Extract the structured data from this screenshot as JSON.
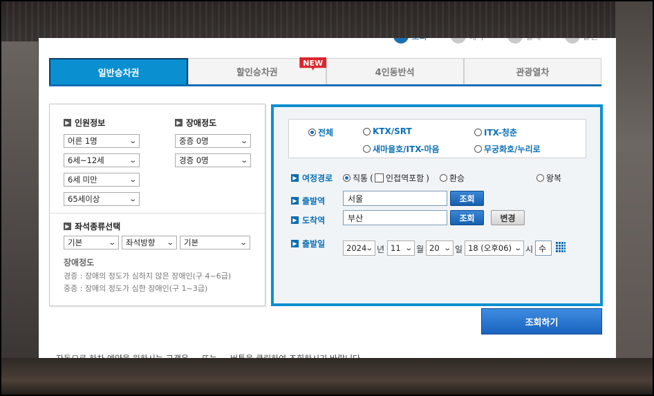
{
  "steps": [
    {
      "label": "조회",
      "active": true
    },
    {
      "label": "예약",
      "active": false
    },
    {
      "label": "결제",
      "active": false
    },
    {
      "label": "발권",
      "active": false
    }
  ],
  "tabs": [
    {
      "label": "일반승차권",
      "active": true
    },
    {
      "label": "할인승차권",
      "active": false,
      "badge": "NEW"
    },
    {
      "label": "4인동반석",
      "active": false
    },
    {
      "label": "관광열차",
      "active": false
    }
  ],
  "passenger": {
    "title": "인원정보",
    "options": [
      "어른 1명",
      "6세~12세",
      "6세 미만",
      "65세이상"
    ]
  },
  "disability": {
    "title": "장애정도",
    "options": [
      "중증 0명",
      "경증 0명"
    ]
  },
  "seat": {
    "title": "좌석종류선택",
    "options": [
      "기본",
      "좌석방향",
      "기본"
    ]
  },
  "disability_info": {
    "title": "장애정도",
    "mild": "경증 : 장애의 정도가 심하지 않은 장애인(구 4~6급)",
    "severe": "중증 : 장애의 정도가 심한 장애인(구 1~3급)"
  },
  "train_types": [
    {
      "label": "전체",
      "checked": true
    },
    {
      "label": "KTX/SRT",
      "checked": false
    },
    {
      "label": "ITX-청춘",
      "checked": false
    },
    {
      "label": "새마을호/ITX-마음",
      "checked": false
    },
    {
      "label": "무궁화호/누리로",
      "checked": false
    }
  ],
  "route": {
    "label": "여정경로",
    "direct": "직통",
    "transfer_check": "인접역포함",
    "transfer": "환승",
    "round": "왕복"
  },
  "departure": {
    "label": "출발역",
    "value": "서울",
    "lookup": "조회"
  },
  "arrival": {
    "label": "도착역",
    "value": "부산",
    "lookup": "조회",
    "swap": "변경"
  },
  "date": {
    "label": "출발일",
    "year": "2024",
    "year_unit": "년",
    "month": "11",
    "month_unit": "월",
    "day": "20",
    "day_unit": "일",
    "hour": "18 (오후06)",
    "hour_unit": "시",
    "weekday": "수"
  },
  "search_button": "조회하기",
  "footer_text": "자동으로 하차 예약을 원하시는 고객은 ... 또는 ... 버튼을 클릭하여 조회하시기 바랍니다"
}
